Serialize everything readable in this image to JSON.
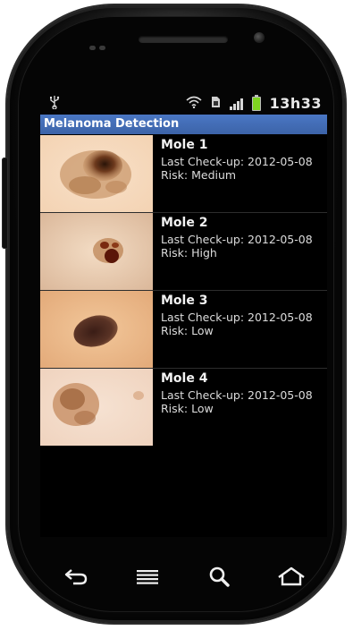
{
  "status": {
    "time": "13h33",
    "icons": [
      "usb-icon",
      "wifi-icon",
      "sim-icon",
      "signal-icon",
      "battery-icon"
    ]
  },
  "app": {
    "title": "Melanoma Detection"
  },
  "moles": [
    {
      "name": "Mole 1",
      "checkup": "Last Check-up: 2012-05-08",
      "risk": "Risk: Medium"
    },
    {
      "name": "Mole 2",
      "checkup": "Last Check-up: 2012-05-08",
      "risk": "Risk: High"
    },
    {
      "name": "Mole 3",
      "checkup": "Last Check-up: 2012-05-08",
      "risk": "Risk: Low"
    },
    {
      "name": "Mole 4",
      "checkup": "Last Check-up: 2012-05-08",
      "risk": "Risk: Low"
    }
  ],
  "navigation": {
    "buttons": [
      "back-icon",
      "menu-icon",
      "search-icon",
      "home-icon"
    ]
  },
  "colors": {
    "titlebar": "#4a77c4",
    "battery": "#7fd321"
  }
}
